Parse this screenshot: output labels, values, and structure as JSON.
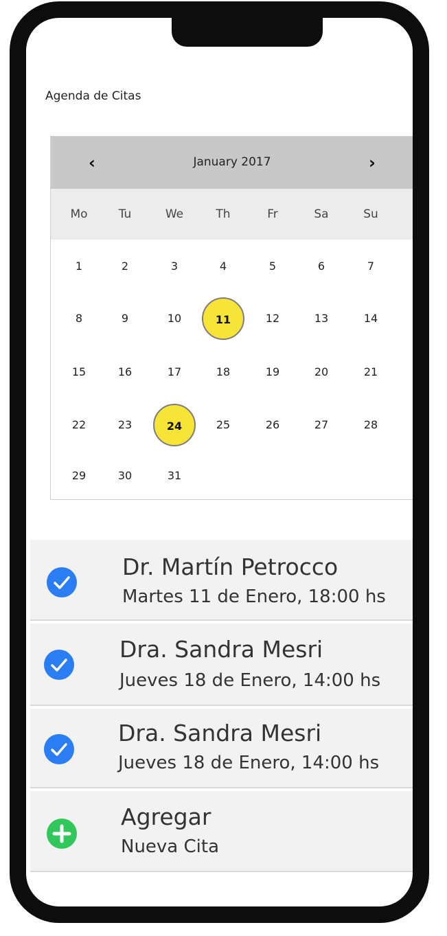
{
  "app": {
    "title": "Agenda de Citas"
  },
  "calendar": {
    "month_label": "January 2017",
    "prev_icon": "chevron-left-icon",
    "next_icon": "chevron-right-icon",
    "weekdays": [
      "Mo",
      "Tu",
      "We",
      "Th",
      "Fr",
      "Sa",
      "Su"
    ],
    "weeks": [
      [
        "1",
        "2",
        "3",
        "4",
        "5",
        "6",
        "7"
      ],
      [
        "8",
        "9",
        "10",
        "11",
        "12",
        "13",
        "14"
      ],
      [
        "15",
        "16",
        "17",
        "18",
        "19",
        "20",
        "21"
      ],
      [
        "22",
        "23",
        "24",
        "25",
        "26",
        "27",
        "28"
      ],
      [
        "29",
        "30",
        "31"
      ]
    ],
    "highlighted_days": [
      "11",
      "24"
    ],
    "highlight_color": "#f6e437"
  },
  "appointments": [
    {
      "name": "Dr. Martín Petrocco",
      "datetime": "Martes 11 de Enero, 18:00 hs",
      "icon": "check-circle-icon",
      "icon_color": "#2b7df3"
    },
    {
      "name": "Dra. Sandra Mesri",
      "datetime": "Jueves 18 de Enero, 14:00 hs",
      "icon": "check-circle-icon",
      "icon_color": "#2b7df3"
    },
    {
      "name": "Dra. Sandra Mesri",
      "datetime": "Jueves 18 de Enero, 14:00 hs",
      "icon": "check-circle-icon",
      "icon_color": "#2b7df3"
    }
  ],
  "add_item": {
    "label": "Agregar",
    "sublabel": "Nueva Cita",
    "icon": "plus-circle-icon",
    "icon_color": "#32c75a"
  }
}
